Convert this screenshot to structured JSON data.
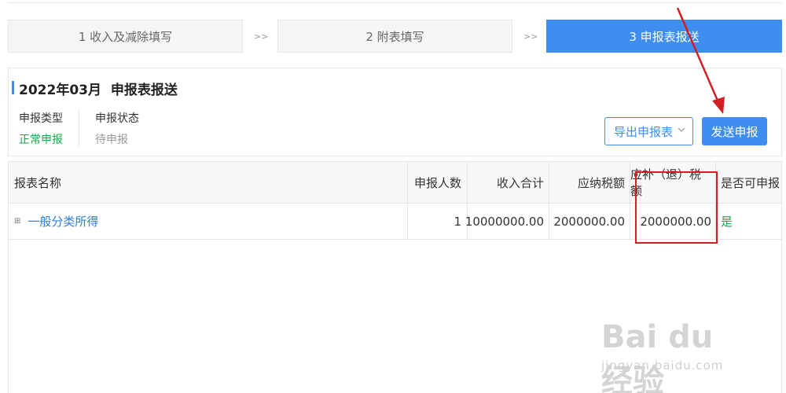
{
  "steps": {
    "step1": "1 收入及减除填写",
    "sep1": ">>",
    "step2": "2 附表填写",
    "sep2": ">>",
    "step3": "3 申报表报送"
  },
  "header": {
    "period_title": "2022年03月",
    "title": "申报表报送",
    "declare_type_label": "申报类型",
    "declare_type_value": "正常申报",
    "declare_status_label": "申报状态",
    "declare_status_value": "待申报",
    "export_button": "导出申报表",
    "send_button": "发送申报"
  },
  "table": {
    "columns": [
      "报表名称",
      "申报人数",
      "收入合计",
      "应纳税额",
      "应补（退）税额",
      "是否可申报"
    ],
    "rows": [
      {
        "expand": "⊞",
        "name": "一般分类所得",
        "people": "1",
        "income": "10000000.00",
        "tax_payable": "2000000.00",
        "tax_due_refund": "2000000.00",
        "can_declare": "是"
      }
    ]
  },
  "colors": {
    "accent": "#3e8eef",
    "success": "#19a84a",
    "annotation_red": "#d21f24"
  },
  "watermark": {
    "logo": "Bai du 经验",
    "url": "jingyan.baidu.com"
  }
}
